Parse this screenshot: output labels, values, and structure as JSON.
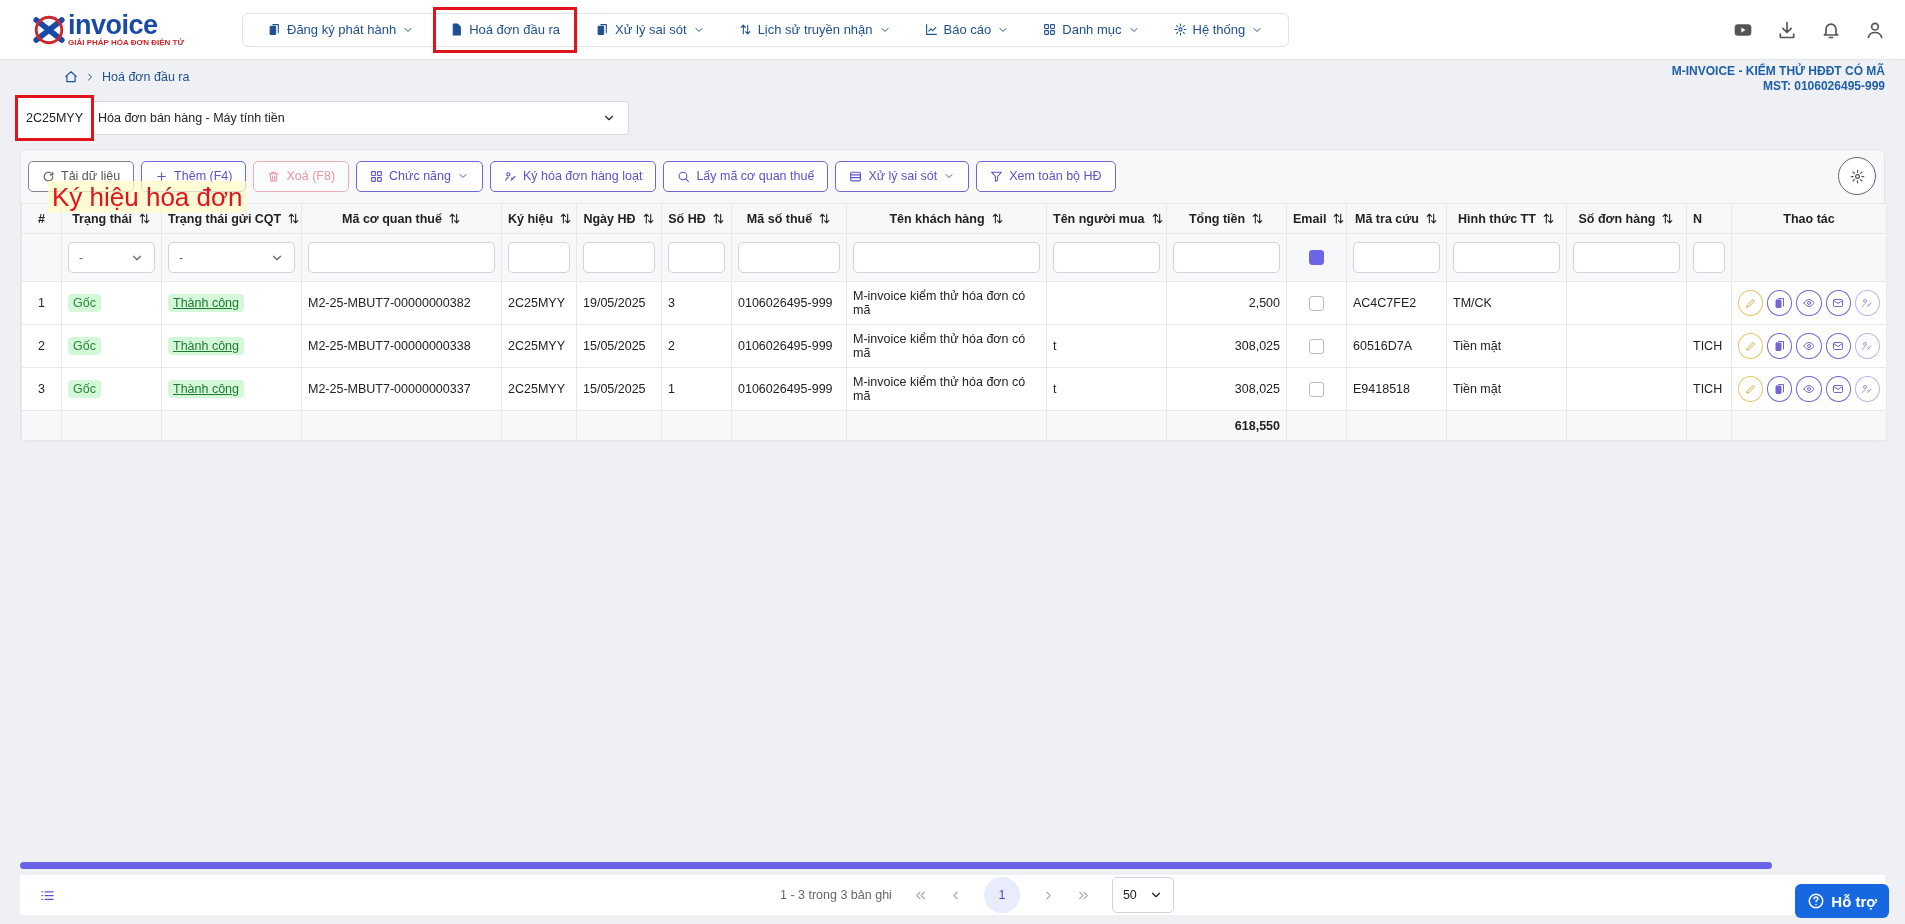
{
  "logo": {
    "brand": "invoice",
    "tagline": "GIẢI PHÁP HÓA ĐƠN ĐIỆN TỬ"
  },
  "nav": [
    {
      "label": "Đăng ký phát hành",
      "has_menu": true,
      "highlighted": false
    },
    {
      "label": "Hoá đơn đầu ra",
      "has_menu": false,
      "highlighted": true
    },
    {
      "label": "Xử lý sai sót",
      "has_menu": true,
      "highlighted": false
    },
    {
      "label": "Lịch sử truyền nhận",
      "has_menu": true,
      "highlighted": false
    },
    {
      "label": "Báo cáo",
      "has_menu": true,
      "highlighted": false
    },
    {
      "label": "Danh mục",
      "has_menu": true,
      "highlighted": false
    },
    {
      "label": "Hệ thống",
      "has_menu": true,
      "highlighted": false
    }
  ],
  "breadcrumb": [
    "Hoá đơn đầu ra"
  ],
  "company": {
    "name": "M-INVOICE - KIỂM THỬ HĐĐT CÓ MÃ",
    "tax_code": "MST: 0106026495-999"
  },
  "series_select": {
    "code": "2C25MYY",
    "code_highlighted": true,
    "value": "Hóa đơn bán hàng - Máy tính tiền"
  },
  "annotation": "Ký hiệu hóa đơn",
  "toolbar": [
    {
      "label": "Tải dữ liệu",
      "kind": "neutral",
      "has_menu": false,
      "disabled": false
    },
    {
      "label": "Thêm (F4)",
      "kind": "primary",
      "has_menu": false,
      "disabled": false
    },
    {
      "label": "Xoá (F8)",
      "kind": "danger",
      "has_menu": false,
      "disabled": true
    },
    {
      "label": "Chức năng",
      "kind": "primary",
      "has_menu": true,
      "disabled": false
    },
    {
      "label": "Ký hóa đơn hàng loạt",
      "kind": "primary",
      "has_menu": false,
      "disabled": false
    },
    {
      "label": "Lấy mã cơ quan thuế",
      "kind": "primary",
      "has_menu": false,
      "disabled": false
    },
    {
      "label": "Xử lý sai sót",
      "kind": "primary",
      "has_menu": true,
      "disabled": false
    },
    {
      "label": "Xem toàn bộ HĐ",
      "kind": "primary",
      "has_menu": false,
      "disabled": false
    }
  ],
  "table": {
    "columns": [
      {
        "label": "#",
        "sortable": false
      },
      {
        "label": "Trạng thái",
        "sortable": true,
        "filter": {
          "kind": "select",
          "value": "-"
        }
      },
      {
        "label": "Trạng thái gửi CQT",
        "sortable": true,
        "filter": {
          "kind": "select",
          "value": "-"
        }
      },
      {
        "label": "Mã cơ quan thuế",
        "sortable": true,
        "filter": {
          "kind": "text"
        }
      },
      {
        "label": "Ký hiệu",
        "sortable": true,
        "filter": {
          "kind": "text"
        }
      },
      {
        "label": "Ngày HĐ",
        "sortable": true,
        "filter": {
          "kind": "text"
        }
      },
      {
        "label": "Số HĐ",
        "sortable": true,
        "filter": {
          "kind": "text"
        }
      },
      {
        "label": "Mã số thuế",
        "sortable": true,
        "filter": {
          "kind": "text"
        }
      },
      {
        "label": "Tên khách hàng",
        "sortable": true,
        "filter": {
          "kind": "text"
        }
      },
      {
        "label": "Tên người mua",
        "sortable": true,
        "filter": {
          "kind": "text"
        }
      },
      {
        "label": "Tổng tiền",
        "sortable": true,
        "filter": {
          "kind": "text"
        }
      },
      {
        "label": "Email",
        "sortable": true,
        "filter": {
          "kind": "checkbox",
          "checked": true
        }
      },
      {
        "label": "Mã tra cứu",
        "sortable": true,
        "filter": {
          "kind": "text"
        }
      },
      {
        "label": "Hình thức TT",
        "sortable": true,
        "filter": {
          "kind": "text"
        }
      },
      {
        "label": "Số đơn hàng",
        "sortable": true,
        "filter": {
          "kind": "text"
        }
      },
      {
        "label": "N",
        "sortable": false,
        "filter": {
          "kind": "text"
        }
      },
      {
        "label": "Thao tác",
        "sortable": false
      }
    ],
    "rows": [
      {
        "num": "1",
        "status": "Gốc",
        "send_status": "Thành công",
        "tax_authority_code": "M2-25-MBUT7-00000000382",
        "series": "2C25MYY",
        "date": "19/05/2025",
        "number": "3",
        "tax_code": "0106026495-999",
        "customer": "M-invoice kiểm thử hóa đơn có mã",
        "buyer": "",
        "total": "2,500",
        "email_checked": false,
        "lookup_code": "AC4C7FE2",
        "payment": "TM/CK",
        "order_no": "",
        "column_16": ""
      },
      {
        "num": "2",
        "status": "Gốc",
        "send_status": "Thành công",
        "tax_authority_code": "M2-25-MBUT7-00000000338",
        "series": "2C25MYY",
        "date": "15/05/2025",
        "number": "2",
        "tax_code": "0106026495-999",
        "customer": "M-invoice kiểm thử hóa đơn có mã",
        "buyer": "t",
        "total": "308,025",
        "email_checked": false,
        "lookup_code": "60516D7A",
        "payment": "Tiền mặt",
        "order_no": "",
        "column_16": "TICH"
      },
      {
        "num": "3",
        "status": "Gốc",
        "send_status": "Thành công",
        "tax_authority_code": "M2-25-MBUT7-00000000337",
        "series": "2C25MYY",
        "date": "15/05/2025",
        "number": "1",
        "tax_code": "0106026495-999",
        "customer": "M-invoice kiểm thử hóa đơn có mã",
        "buyer": "t",
        "total": "308,025",
        "email_checked": false,
        "lookup_code": "E9418518",
        "payment": "Tiền mặt",
        "order_no": "",
        "column_16": "TICH"
      }
    ],
    "total": "618,550"
  },
  "pager": {
    "summary": "1 - 3 trong 3 bản ghi",
    "pages": [
      {
        "label": "1",
        "selected": true
      }
    ],
    "page_size": "50"
  },
  "help_button": "Hỗ trợ"
}
